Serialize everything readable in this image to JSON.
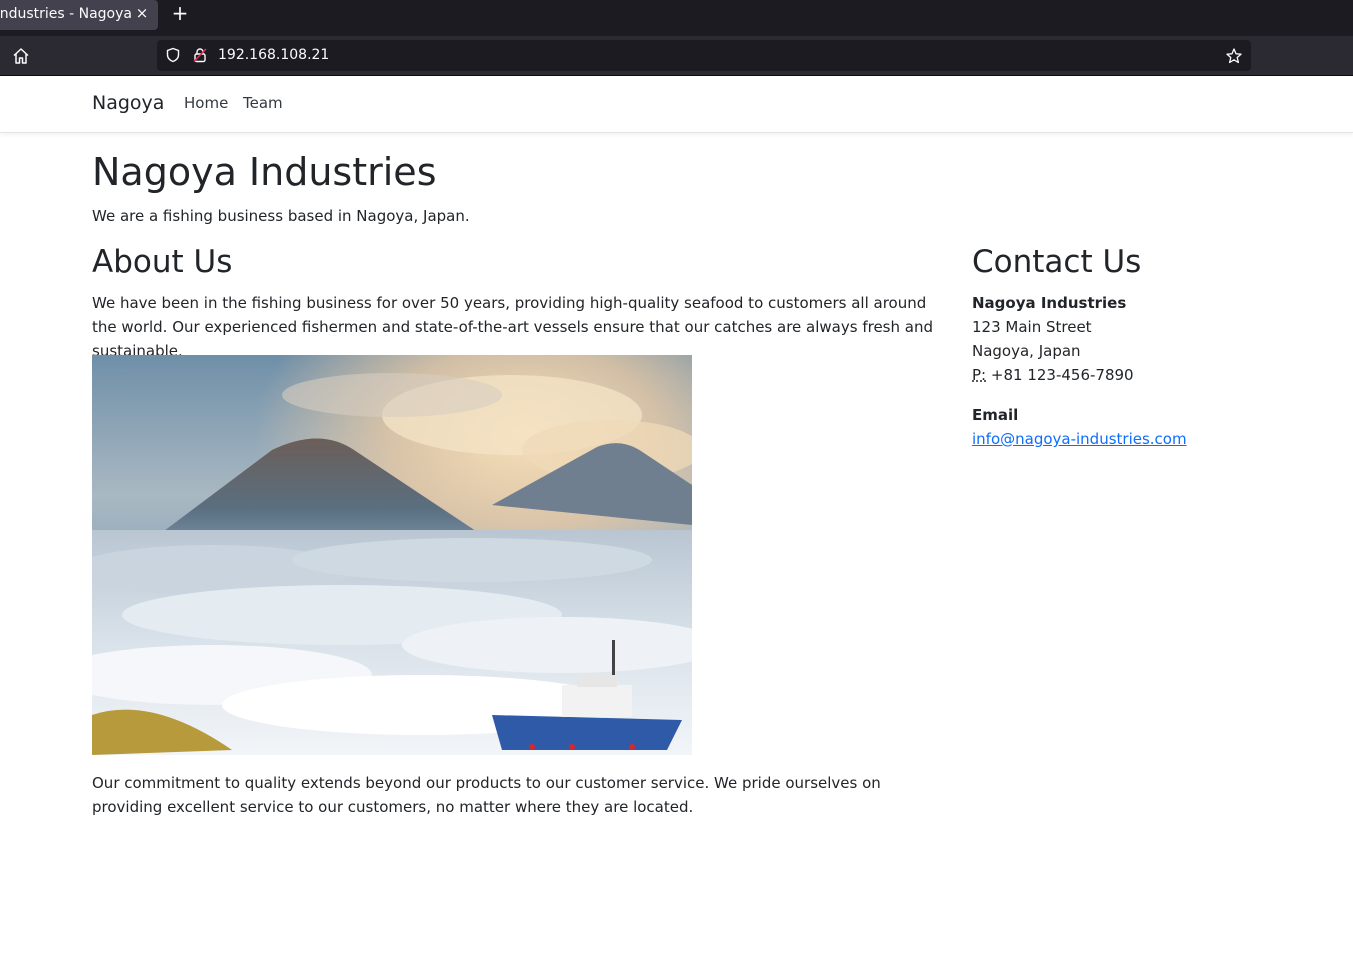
{
  "browser": {
    "tab_title": "Nagoya Industries - Nagoya",
    "tab_close_glyph": "×",
    "new_tab_glyph": "+",
    "url": "192.168.108.21"
  },
  "site": {
    "brand": "Nagoya",
    "nav": [
      {
        "label": "Home"
      },
      {
        "label": "Team"
      }
    ]
  },
  "main": {
    "title": "Nagoya Industries",
    "lead": "We are a fishing business based in Nagoya, Japan.",
    "about": {
      "heading": "About Us",
      "paragraph1": "We have been in the fishing business for over 50 years, providing high-quality seafood to customers all around the world. Our experienced fishermen and state-of-the-art vessels ensure that our catches are always fresh and sustainable.",
      "paragraph2": "Our commitment to quality extends beyond our products to our customer service. We pride ourselves on providing excellent service to our customers, no matter where they are located."
    },
    "contact": {
      "heading": "Contact Us",
      "company": "Nagoya Industries",
      "street": "123 Main Street",
      "city": "Nagoya, Japan",
      "phone_label": "P:",
      "phone": "+81 123-456-7890",
      "email_label": "Email",
      "email": "info@nagoya-industries.com"
    }
  },
  "icons": {
    "home": "home-icon",
    "shield": "shield-icon",
    "lock": "insecure-lock-icon",
    "star": "bookmark-star-icon"
  },
  "colors": {
    "link": "#0d6efd",
    "text": "#212529",
    "chrome_dark": "#1c1b22"
  }
}
